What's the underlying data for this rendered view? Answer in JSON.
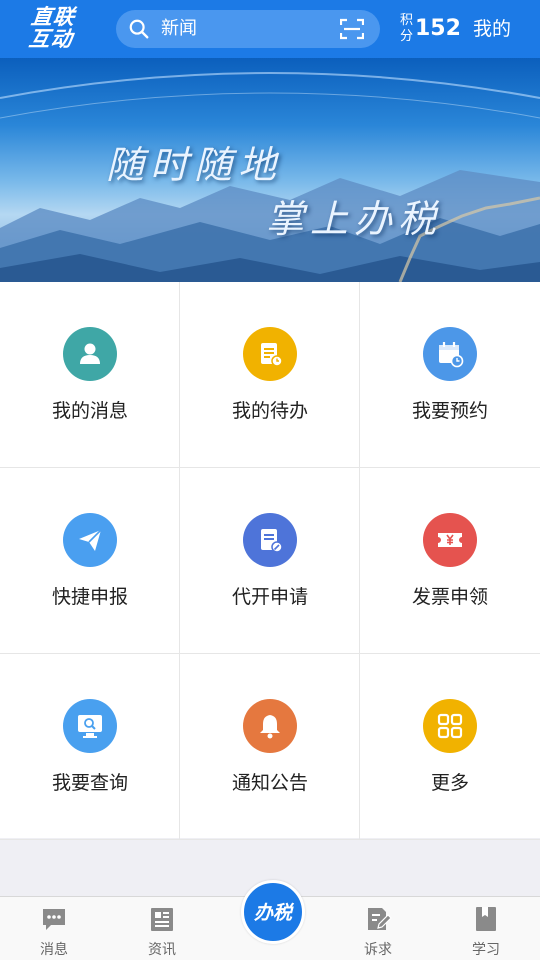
{
  "header": {
    "logo_line1": "直联",
    "logo_line2": "互动",
    "search_placeholder": "新闻",
    "search_icon": "search-icon",
    "scan_icon": "scan-icon",
    "points_label": "积分",
    "points_value": "152",
    "mine_label": "我的"
  },
  "banner": {
    "line1": "随时随地",
    "line2": "掌上办税"
  },
  "grid": {
    "items": [
      {
        "label": "我的消息",
        "icon": "person-icon",
        "color": "#3fa7a6"
      },
      {
        "label": "我的待办",
        "icon": "todo-document-icon",
        "color": "#f1b200"
      },
      {
        "label": "我要预约",
        "icon": "calendar-icon",
        "color": "#4c97e8"
      },
      {
        "label": "快捷申报",
        "icon": "paper-plane-icon",
        "color": "#4a9ff0"
      },
      {
        "label": "代开申请",
        "icon": "edit-document-icon",
        "color": "#4e74d9"
      },
      {
        "label": "发票申领",
        "icon": "invoice-yen-icon",
        "color": "#e5534f"
      },
      {
        "label": "我要查询",
        "icon": "monitor-search-icon",
        "color": "#49a0ef"
      },
      {
        "label": "通知公告",
        "icon": "bell-icon",
        "color": "#e5783f"
      },
      {
        "label": "更多",
        "icon": "grid-more-icon",
        "color": "#f1b200"
      }
    ]
  },
  "tabbar": {
    "tabs": [
      {
        "label": "消息",
        "icon": "chat-bubble-icon"
      },
      {
        "label": "资讯",
        "icon": "newspaper-icon"
      },
      {
        "label": "诉求",
        "icon": "document-pen-icon"
      },
      {
        "label": "学习",
        "icon": "book-icon"
      }
    ],
    "center_label": "办税",
    "icon_color": "#8a8a8a",
    "accent": "#1c7ae6"
  }
}
